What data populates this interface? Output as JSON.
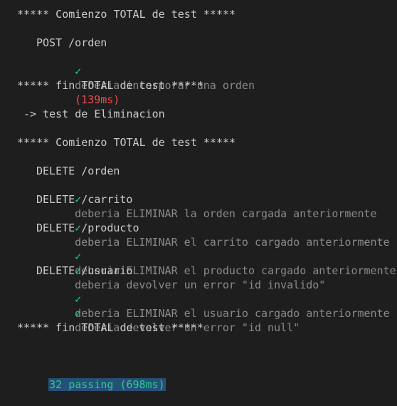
{
  "terminal": {
    "lines": {
      "start1": "***** Comienzo TOTAL de test *****",
      "post_suite": "POST /orden",
      "post_test": "deberia incorporar una orden",
      "post_time": "(139ms)",
      "end1": "***** fin TOTAL de test *****",
      "elim_header": "-> test de Eliminacion",
      "start2": "***** Comienzo TOTAL de test *****",
      "del_orden": "DELETE /orden",
      "del_orden_t1": "deberia ELIMINAR la orden cargada anteriormente",
      "del_carrito": "DELETE /carrito",
      "del_carrito_t1": "deberia ELIMINAR el carrito cargado anteriormente",
      "del_producto": "DELETE /producto",
      "del_producto_t1": "deberia ELIMINAR el producto cargado anteriormente",
      "del_producto_t2": "deberia devolver un error \"id invalido\"",
      "del_usuario": "DELETE /usuario",
      "del_usuario_t1": "deberia ELIMINAR el usuario cargado anteriormente",
      "del_usuario_t2": "deberia devolver un error \"id null\"",
      "end2": "***** fin TOTAL de test *****",
      "passing": "32 passing (698ms)"
    },
    "check_glyph": "✓",
    "colors": {
      "background": "#1e1e1e",
      "text": "#cccccc",
      "check": "#23d18b",
      "description": "#8a8a8a",
      "slow_time": "#f14c4c",
      "selection": "#264f78"
    }
  }
}
